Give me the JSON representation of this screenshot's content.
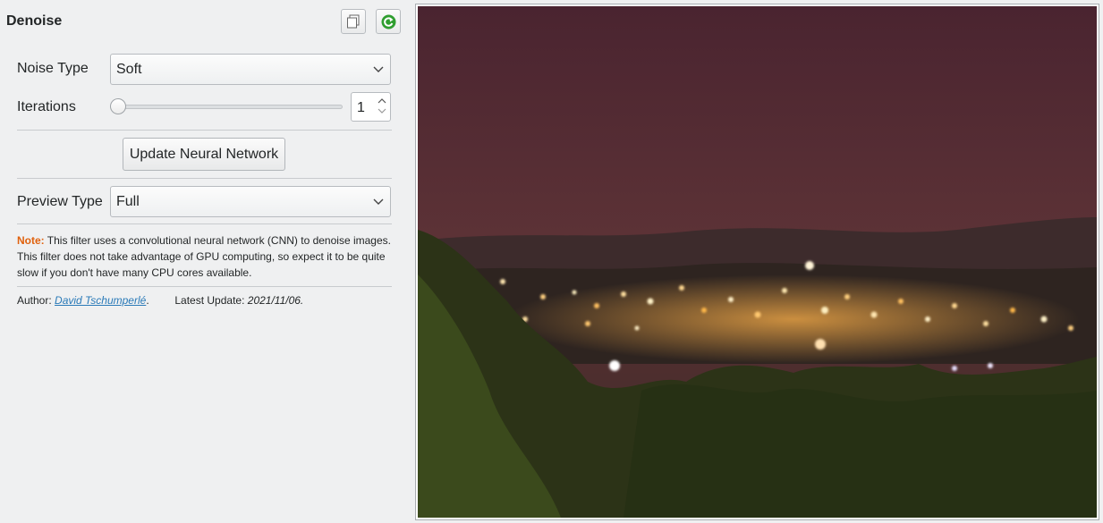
{
  "filter": {
    "title": "Denoise",
    "icons": {
      "copy": "copy-icon",
      "refresh": "refresh-icon"
    }
  },
  "params": {
    "noise_type": {
      "label": "Noise Type",
      "value": "Soft"
    },
    "iterations": {
      "label": "Iterations",
      "value": "1",
      "slider_fraction": 0.0
    },
    "update_button": "Update Neural Network",
    "preview_type": {
      "label": "Preview Type",
      "value": "Full"
    }
  },
  "note": {
    "prefix": "Note:",
    "text": "This filter uses a convolutional neural network (CNN) to denoise images. This filter does not take advantage of GPU computing, so expect it to be quite slow if you don't have many CPU cores available."
  },
  "author": {
    "label": "Author:",
    "name": "David Tschumperlé",
    "suffix": ".",
    "update_label": "Latest Update:",
    "update_date": "2021/11/06."
  },
  "colors": {
    "note_accent": "#e0610d",
    "link": "#2a7ab8",
    "refresh_green": "#2f9e2f"
  }
}
